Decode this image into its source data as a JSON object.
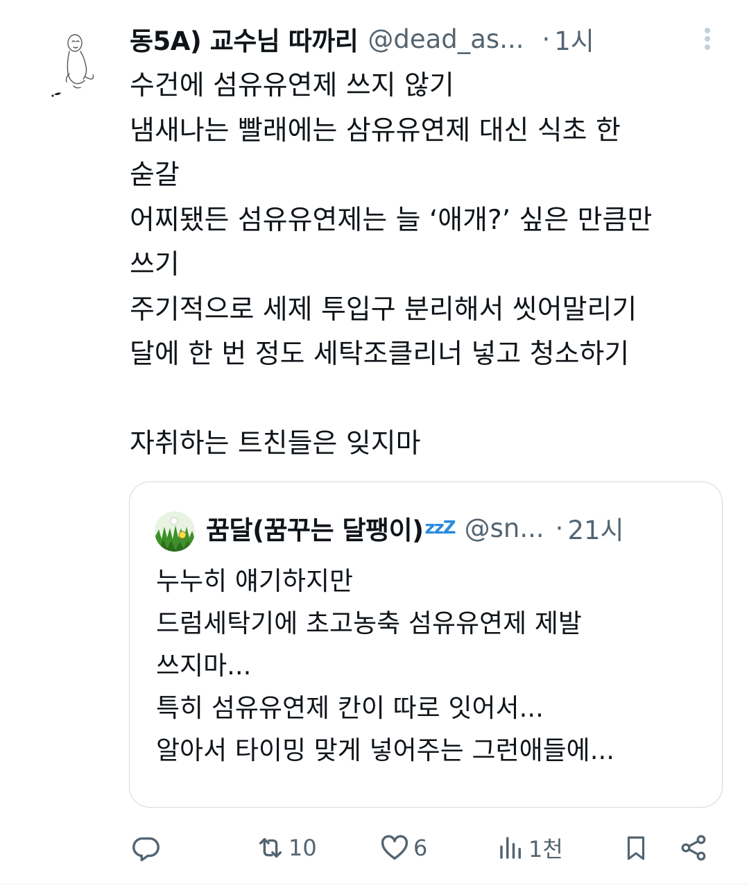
{
  "tweet": {
    "author_name": "동5A) 교수님 따까리",
    "handle": "@dead_as...",
    "dot": "·",
    "time": "1시",
    "lines": [
      "수건에 섬유유연제 쓰지 않기",
      "냄새나는 빨래에는 삼유유연제 대신 식초 한",
      "숟갈",
      "어찌됐든 섬유유연제는 늘 ‘애개?’ 싶은 만큼만",
      "쓰기",
      "주기적으로 세제 투입구 분리해서 씻어말리기",
      "달에 한 번 정도 세탁조클리너 넣고 청소하기",
      "",
      "자취하는 트친들은 잊지마"
    ]
  },
  "quoted": {
    "author_name": "꿈달(꿈꾸는 달팽이)",
    "name_suffix": "zzZ",
    "handle": "@sn...",
    "dot": "·",
    "time": "21시",
    "lines": [
      "누누히 얘기하지만",
      "드럼세탁기에 초고농축 섬유유연제 제발",
      "쓰지마...",
      "특히 섬유유연제 칸이 따로 잇어서...",
      "알아서 타이밍 맞게 넣어주는 그런애들에..."
    ]
  },
  "actions": {
    "reply_icon": "reply-icon",
    "retweet_count": "10",
    "like_count": "6",
    "views_count": "1천",
    "bookmark_icon": "bookmark-icon",
    "share_icon": "share-icon"
  },
  "colors": {
    "text": "#0f1419",
    "secondary": "#536471",
    "border": "#cfd9de",
    "zzz_accent": "#2a8be0"
  }
}
